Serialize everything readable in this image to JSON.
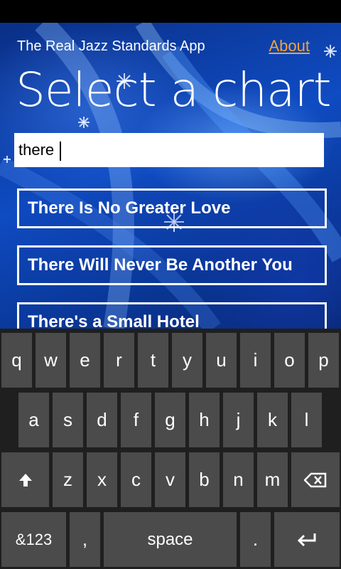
{
  "header": {
    "app_title": "The Real Jazz Standards App",
    "about_link": "About",
    "page_title": "Select a chart"
  },
  "search": {
    "value": "there",
    "placeholder": ""
  },
  "results": [
    {
      "label": "There Is No Greater Love"
    },
    {
      "label": "There Will Never Be Another You"
    },
    {
      "label": "There's a Small Hotel"
    }
  ],
  "keyboard": {
    "row1": [
      "q",
      "w",
      "e",
      "r",
      "t",
      "y",
      "u",
      "i",
      "o",
      "p"
    ],
    "row2": [
      "a",
      "s",
      "d",
      "f",
      "g",
      "h",
      "j",
      "k",
      "l"
    ],
    "row3": [
      "z",
      "x",
      "c",
      "v",
      "b",
      "n",
      "m"
    ],
    "symbols_label": "&123",
    "comma_label": ",",
    "space_label": "space",
    "period_label": ".",
    "shift_icon": "shift-arrow-icon",
    "backspace_icon": "backspace-icon",
    "enter_icon": "enter-icon"
  },
  "colors": {
    "accent_link": "#f0a33a",
    "key_bg": "#4b4b4b",
    "keyboard_bg": "#1f1f1f",
    "background_blue": "#0f4bc2"
  }
}
